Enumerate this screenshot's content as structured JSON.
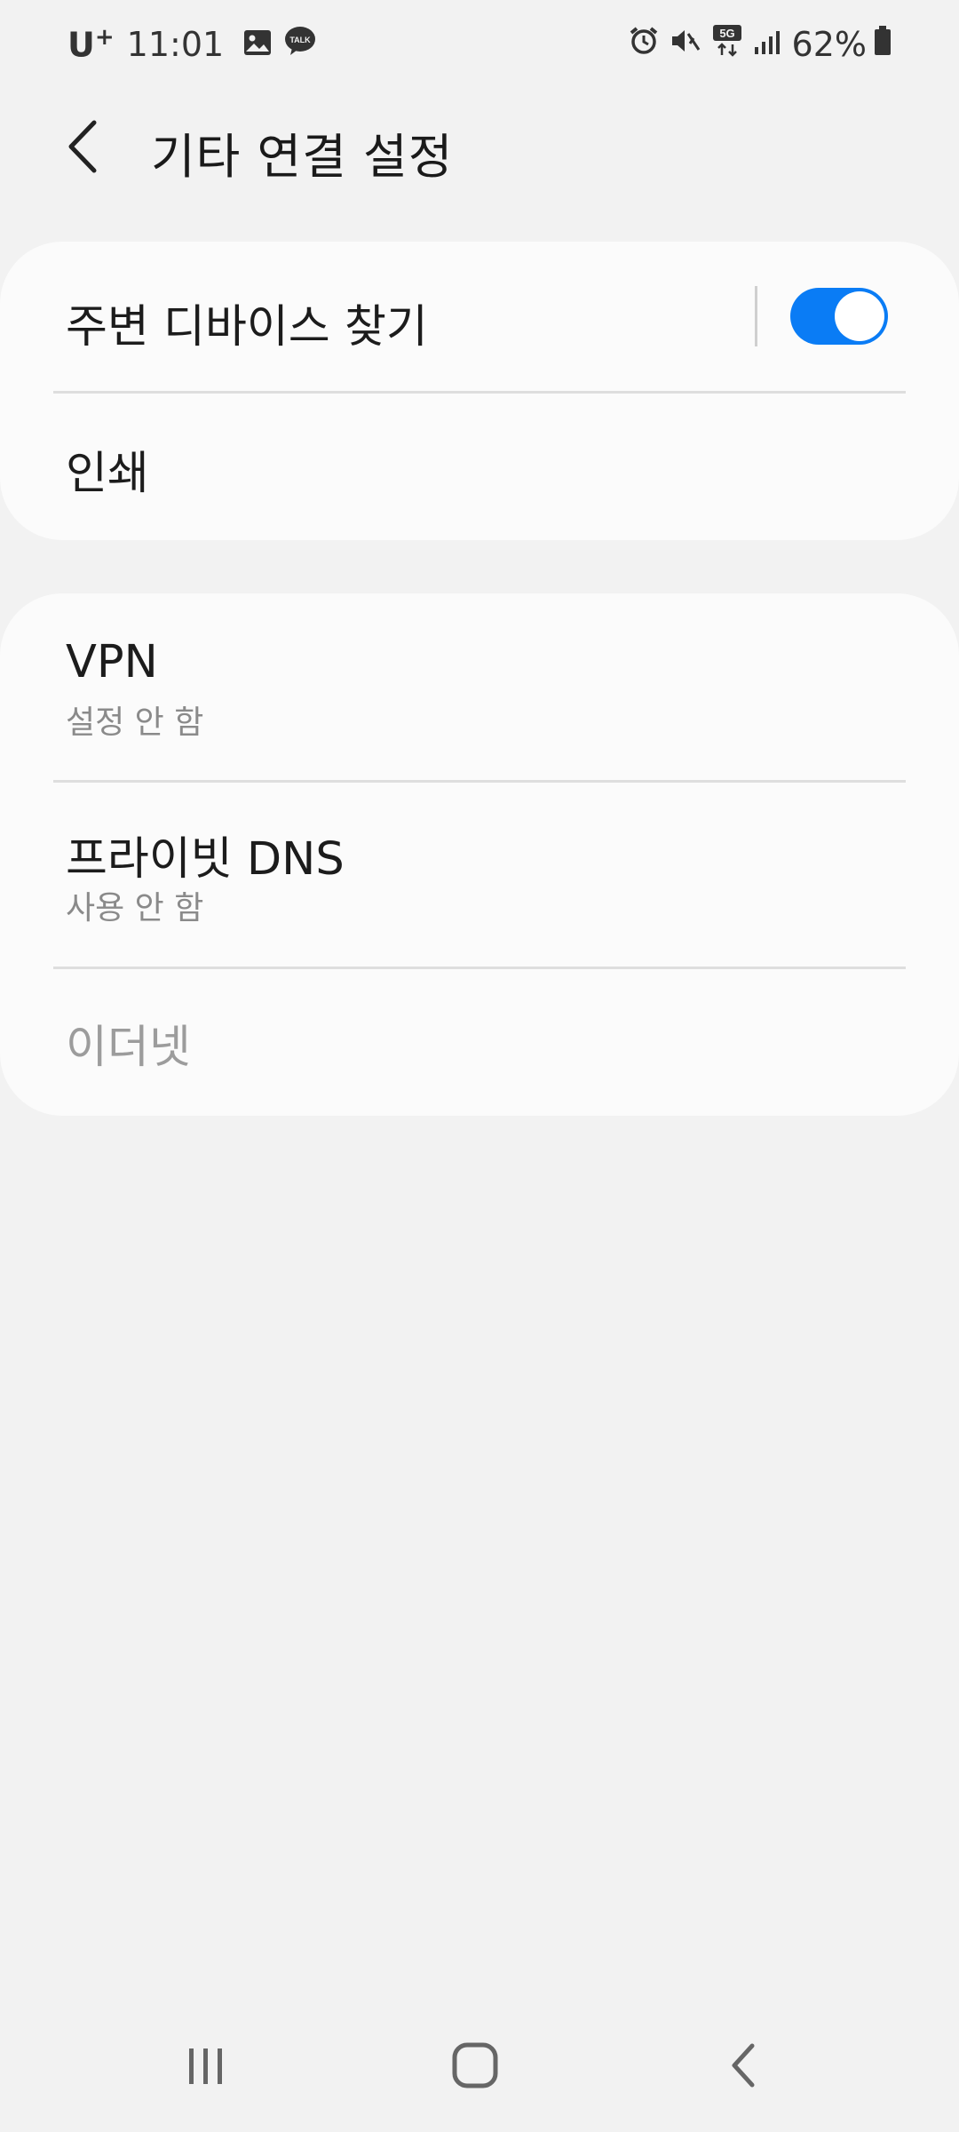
{
  "status_bar": {
    "carrier": "U",
    "carrier_sup": "+",
    "time": "11:01",
    "talk_label": "TALK",
    "fiveg_label": "5G",
    "battery": "62%",
    "icons_left": [
      "gallery-icon",
      "kakaotalk-icon"
    ],
    "icons_right": [
      "alarm-icon",
      "vibrate-mute-icon",
      "5g-data-icon",
      "signal-icon",
      "battery-icon"
    ]
  },
  "header": {
    "title": "기타 연결 설정"
  },
  "section1": {
    "items": [
      {
        "title": "주변 디바이스 찾기",
        "toggle_on": true
      },
      {
        "title": "인쇄"
      }
    ]
  },
  "section2": {
    "items": [
      {
        "title": "VPN",
        "subtitle": "설정 안 함"
      },
      {
        "title": "프라이빗 DNS",
        "subtitle": "사용 안 함"
      },
      {
        "title": "이더넷",
        "disabled": true
      }
    ]
  },
  "colors": {
    "accent": "#0a7cf5",
    "background": "#f2f2f2",
    "card": "#fbfbfb",
    "disabled_text": "#9c9c9c"
  },
  "nav_bar": {
    "buttons": [
      "recent-apps-icon",
      "home-icon",
      "back-icon"
    ]
  }
}
